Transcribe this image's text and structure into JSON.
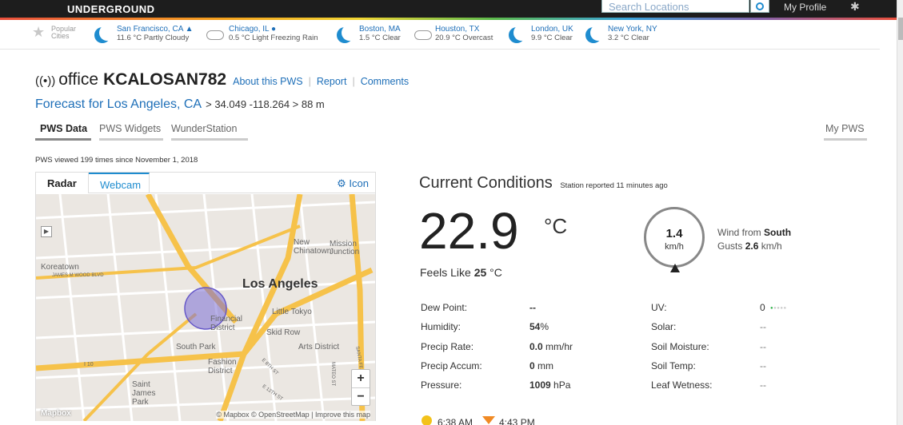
{
  "header": {
    "logo_text": "UNDERGROUND",
    "search_placeholder": "Search Locations",
    "my_profile": "My Profile"
  },
  "popular": {
    "label_line1": "Popular",
    "label_line2": "Cities",
    "cities": [
      {
        "name": "San Francisco, CA ▲",
        "weather": "11.6 °C Partly Cloudy",
        "icon": "partly-cloudy-moon-icon"
      },
      {
        "name": "Chicago, IL ●",
        "weather": "0.5 °C Light Freezing Rain",
        "icon": "freezing-rain-cloud-icon"
      },
      {
        "name": "Boston, MA",
        "weather": "1.5 °C Clear",
        "icon": "moon-icon"
      },
      {
        "name": "Houston, TX",
        "weather": "20.9 °C Overcast",
        "icon": "cloud-icon"
      },
      {
        "name": "London, UK",
        "weather": "9.9 °C Clear",
        "icon": "moon-icon"
      },
      {
        "name": "New York, NY",
        "weather": "3.2 °C Clear",
        "icon": "moon-icon"
      }
    ]
  },
  "station": {
    "antenna": "((•))",
    "office": "office",
    "id": "KCALOSAN782",
    "about": "About this PWS",
    "report": "Report",
    "comments": "Comments",
    "sep": "|"
  },
  "forecast": {
    "link": "Forecast for Los Angeles, CA",
    "coords": "> 34.049 -118.264 > 88 m"
  },
  "tabs": {
    "pws_data": "PWS Data",
    "pws_widgets": "PWS Widgets",
    "wunderstation": "WunderStation",
    "my_pws": "My PWS"
  },
  "viewed": "PWS viewed 199 times since November 1, 2018",
  "map": {
    "tab_radar": "Radar",
    "tab_webcam": "Webcam",
    "icon_link": "⚙ Icon",
    "labels": {
      "koreatown": "Koreatown",
      "james_wood": "JAMES M WOOD BLVD",
      "new_chinatown": "New\nChinatown",
      "mission_junction": "Mission\nJunction",
      "los_angeles": "Los Angeles",
      "little_tokyo": "Little Tokyo",
      "financial": "Financial\nDistrict",
      "skid_row": "Skid Row",
      "south_park": "South Park",
      "arts_district": "Arts District",
      "fashion_district": "Fashion\nDistrict",
      "saint_james": "Saint\nJames\nPark",
      "i10": "I 10",
      "santa_fe": "SANTA FE AVE",
      "mateo": "MATEO ST",
      "e8th": "E 8TH ST",
      "e12th": "E 12TH ST"
    },
    "zoom_in": "+",
    "zoom_out": "−",
    "layer": "▶",
    "attribution": "© Mapbox © OpenStreetMap | Improve this map",
    "mapbox_logo": "Mapbox"
  },
  "conditions": {
    "title": "Current Conditions",
    "reported": "Station reported 11 minutes ago",
    "temperature": "22.9",
    "temp_unit": "°C",
    "feels_label": "Feels Like",
    "feels_value": "25",
    "feels_unit": "°C",
    "wind_speed": "1.4",
    "wind_unit": "km/h",
    "wind_from_label": "Wind from",
    "wind_from": "South",
    "gusts_label": "Gusts",
    "gusts_value": "2.6",
    "gusts_unit": "km/h",
    "left_rows": [
      {
        "label": "Dew Point:",
        "value": "--",
        "unit": ""
      },
      {
        "label": "Humidity:",
        "value": "54",
        "unit": "%"
      },
      {
        "label": "Precip Rate:",
        "value": "0.0",
        "unit": " mm/hr"
      },
      {
        "label": "Precip Accum:",
        "value": "0",
        "unit": " mm"
      },
      {
        "label": "Pressure:",
        "value": "1009",
        "unit": " hPa"
      }
    ],
    "right_rows": [
      {
        "label": "UV:",
        "value": "0"
      },
      {
        "label": "Solar:",
        "value": "--"
      },
      {
        "label": "Soil Moisture:",
        "value": "--"
      },
      {
        "label": "Soil Temp:",
        "value": "--"
      },
      {
        "label": "Leaf Wetness:",
        "value": "--"
      }
    ],
    "sunrise": "6:38 AM",
    "sunset": "4:43 PM"
  }
}
